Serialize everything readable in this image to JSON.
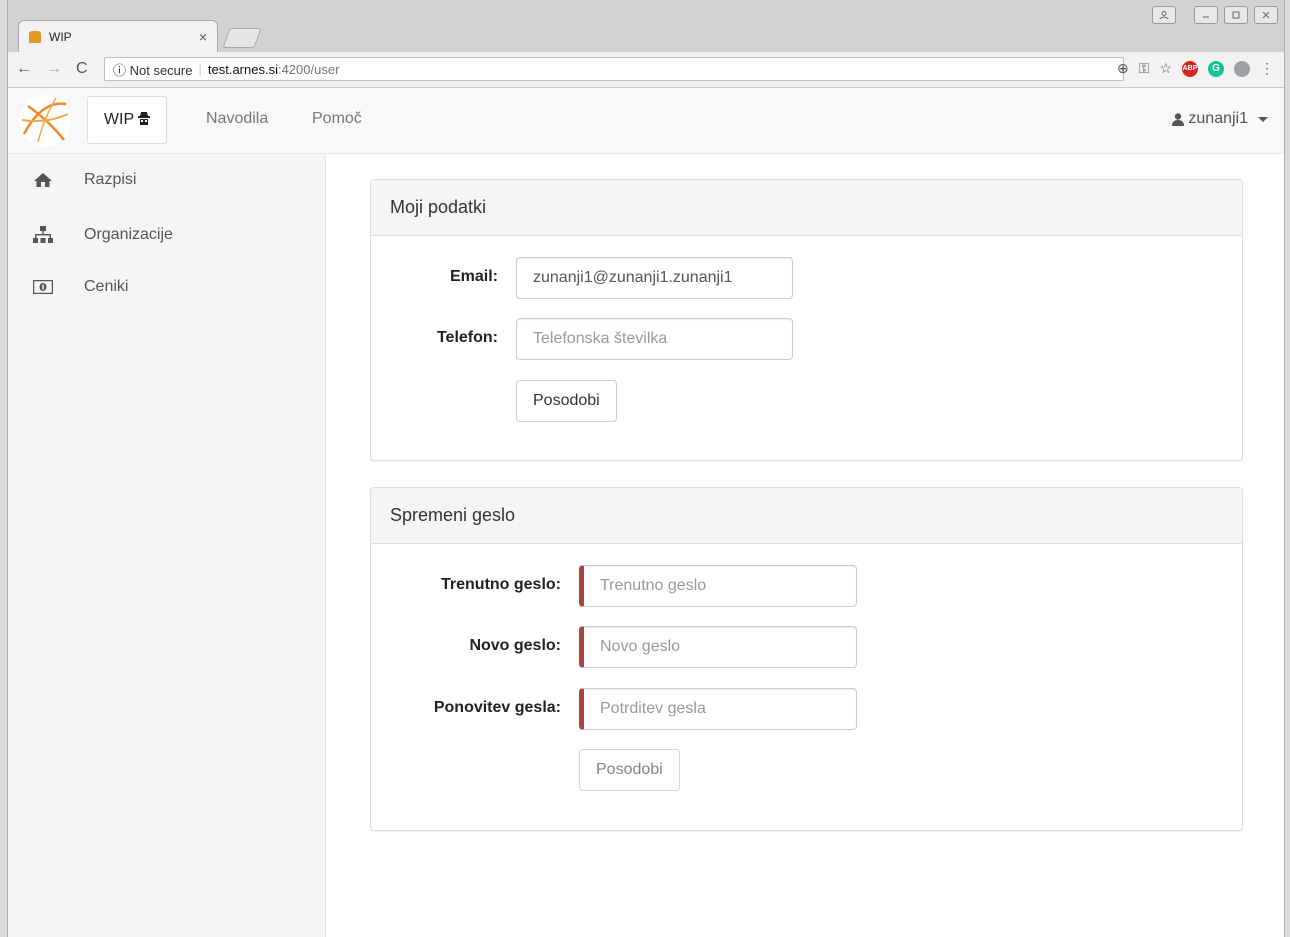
{
  "browser": {
    "tab_title": "WIP",
    "tab_close": "×",
    "security_label": "ⓘ Not secure",
    "url_host": "test.arnes.si",
    "url_path": ":4200/user",
    "ext_abp_label": "ABP",
    "ext_g_label": "G"
  },
  "navbar": {
    "brand": "WIP",
    "links": [
      "Navodila",
      "Pomoč"
    ],
    "user": "zunanji1"
  },
  "sidebar": {
    "items": [
      {
        "label": "Razpisi",
        "icon": "home-icon"
      },
      {
        "label": "Organizacije",
        "icon": "sitemap-icon"
      },
      {
        "label": "Ceniki",
        "icon": "money-icon"
      }
    ]
  },
  "profile": {
    "title": "Moji podatki",
    "email_label": "Email:",
    "email_value": "zunanji1@zunanji1.zunanji1",
    "phone_label": "Telefon:",
    "phone_placeholder": "Telefonska številka",
    "submit": "Posodobi"
  },
  "password": {
    "title": "Spremeni geslo",
    "current_label": "Trenutno geslo:",
    "current_placeholder": "Trenutno geslo",
    "new_label": "Novo geslo:",
    "new_placeholder": "Novo geslo",
    "repeat_label": "Ponovitev gesla:",
    "repeat_placeholder": "Potrditev gesla",
    "submit": "Posodobi"
  },
  "colors": {
    "required_border": "#a94442",
    "brand_orange": "#f08a24"
  }
}
